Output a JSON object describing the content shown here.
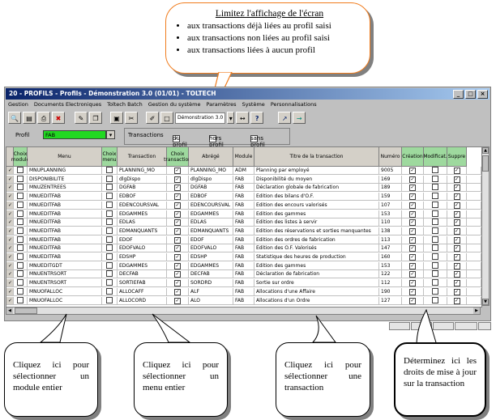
{
  "top_callout": {
    "title": "Limitez l'affichage de l'écran",
    "items": [
      "aux transactions déjà liées au profil saisi",
      "aux transactions non liées au profil saisi",
      "aux transactions liées à aucun profil"
    ]
  },
  "window": {
    "title": "20 - PROFILS - Profils - Démonstration 3.0 (01/01) - TOLTECH",
    "buttons": [
      "_",
      "□",
      "×"
    ]
  },
  "menu": [
    "Gestion",
    "Documents Electroniques",
    "Toltech Batch",
    "Gestion du système",
    "Paramètres",
    "Système",
    "Personnalisations"
  ],
  "toolbar": {
    "selector": "Démonstration 3.0"
  },
  "filter": {
    "profil_label": "Profil",
    "profil_value": "FAB",
    "transactions_label": "Transactions",
    "du_profil": "du profil",
    "hors_profil": "hors profil",
    "sans_profil": "sans profil"
  },
  "columns": [
    "Choix module",
    "Menu",
    "Choix menu",
    "Transaction",
    "Choix transaction",
    "Abrégé",
    "Module",
    "Titre de la transaction",
    "Numéro",
    "Création",
    "Modificat.",
    "Suppre"
  ],
  "rows": [
    {
      "menu": "MNUPLANNING",
      "transaction": "PLANNING_MO",
      "abrege": "PLANNING_MO",
      "module": "ADM",
      "titre": "Planning par employé",
      "numero": "9005"
    },
    {
      "menu": "DISPONIBILITE",
      "transaction": "dlgDispo",
      "abrege": "dlgDispo",
      "module": "FAB",
      "titre": "Disponibilité du moyen",
      "numero": "169"
    },
    {
      "menu": "MNUZENTREES",
      "transaction": "DGFAB",
      "abrege": "DGFAB",
      "module": "FAB",
      "titre": "Déclaration globale de fabrication",
      "numero": "189"
    },
    {
      "menu": "MNUEDITFAB",
      "transaction": "EDBOF",
      "abrege": "EDBOF",
      "module": "FAB",
      "titre": "Edition des bilans d'O.F.",
      "numero": "159"
    },
    {
      "menu": "MNUEDITFAB",
      "transaction": "EDENCOURSVAL",
      "abrege": "EDENCOURSVAL",
      "module": "FAB",
      "titre": "Edition des encours valorisés",
      "numero": "107"
    },
    {
      "menu": "MNUEDITFAB",
      "transaction": "EDGAMMES",
      "abrege": "EDGAMMES",
      "module": "FAB",
      "titre": "Edition des gammes",
      "numero": "153"
    },
    {
      "menu": "MNUEDITFAB",
      "transaction": "EDLAS",
      "abrege": "EDLAS",
      "module": "FAB",
      "titre": "Edition des listes à servir",
      "numero": "110"
    },
    {
      "menu": "MNUEDITFAB",
      "transaction": "EDMANQUANTS",
      "abrege": "EDMANQUANTS",
      "module": "FAB",
      "titre": "Edition des réservations et sorties manquantes",
      "numero": "138"
    },
    {
      "menu": "MNUEDITFAB",
      "transaction": "EDOF",
      "abrege": "EDOF",
      "module": "FAB",
      "titre": "Edition des ordres de fabrication",
      "numero": "113"
    },
    {
      "menu": "MNUEDITFAB",
      "transaction": "EDOFVALO",
      "abrege": "EDOFVALO",
      "module": "FAB",
      "titre": "Edition des O.F. Valorisés",
      "numero": "147"
    },
    {
      "menu": "MNUEDITFAB",
      "transaction": "EDSHP",
      "abrege": "EDSHP",
      "module": "FAB",
      "titre": "Statistique des heures de production",
      "numero": "160"
    },
    {
      "menu": "MNUEDITGDT",
      "transaction": "EDGAMMES",
      "abrege": "EDGAMMES",
      "module": "FAB",
      "titre": "Edition des gammes",
      "numero": "153"
    },
    {
      "menu": "MNUENTRSORT",
      "transaction": "DECFAB",
      "abrege": "DECFAB",
      "module": "FAB",
      "titre": "Déclaration de fabrication",
      "numero": "122"
    },
    {
      "menu": "MNUENTRSORT",
      "transaction": "SORTIEFAB",
      "abrege": "SORDRD",
      "module": "FAB",
      "titre": "Sortie sur ordre",
      "numero": "112"
    },
    {
      "menu": "MNUOFALLOC",
      "transaction": "ALLOCAFF",
      "abrege": "ALF",
      "module": "FAB",
      "titre": "Allocations d'une Affaire",
      "numero": "190"
    },
    {
      "menu": "MNUOFALLOC",
      "transaction": "ALLOCORD",
      "abrege": "ALO",
      "module": "FAB",
      "titre": "Allocations d'un Ordre",
      "numero": "127"
    }
  ],
  "callouts": {
    "module": "Cliquez ici pour sélectionner un module entier",
    "menu": "Cliquez ici pour sélectionner un menu entier",
    "transaction": "Cliquez ici pour sélectionner une transaction",
    "droits": "Déterminez ici les droits de mise à jour sur la transaction"
  }
}
